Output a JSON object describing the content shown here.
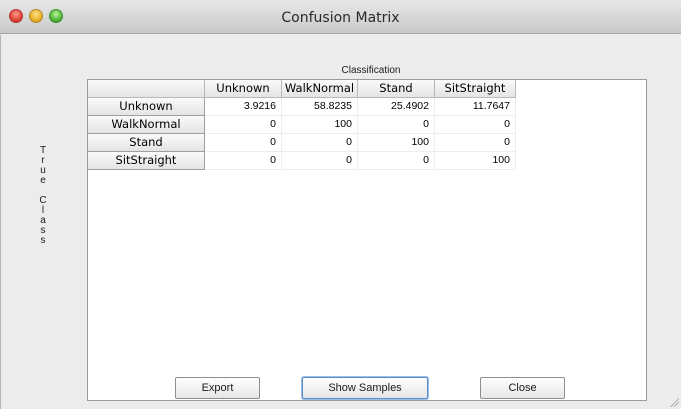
{
  "window": {
    "title": "Confusion Matrix"
  },
  "matrix": {
    "column_axis_label": "Classification",
    "row_axis_label": "True Class",
    "columns": [
      "Unknown",
      "WalkNormal",
      "Stand",
      "SitStraight"
    ],
    "rows": [
      {
        "label": "Unknown",
        "values": [
          "3.9216",
          "58.8235",
          "25.4902",
          "11.7647"
        ]
      },
      {
        "label": "WalkNormal",
        "values": [
          "0",
          "100",
          "0",
          "0"
        ]
      },
      {
        "label": "Stand",
        "values": [
          "0",
          "0",
          "100",
          "0"
        ]
      },
      {
        "label": "SitStraight",
        "values": [
          "0",
          "0",
          "0",
          "100"
        ]
      }
    ]
  },
  "buttons": {
    "export": "Export",
    "show_samples": "Show Samples",
    "close": "Close"
  }
}
